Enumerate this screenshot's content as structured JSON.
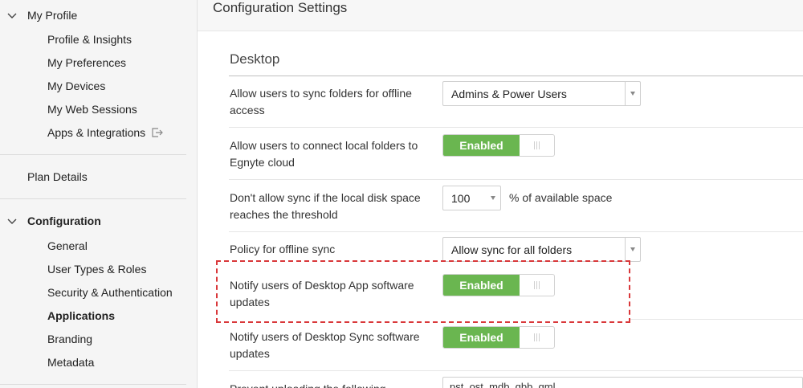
{
  "sidebar": {
    "my_profile": {
      "label": "My Profile",
      "items": [
        "Profile & Insights",
        "My Preferences",
        "My Devices",
        "My Web Sessions",
        "Apps & Integrations"
      ]
    },
    "plan_details": "Plan Details",
    "configuration": {
      "label": "Configuration",
      "items": [
        "General",
        "User Types & Roles",
        "Security & Authentication",
        "Applications",
        "Branding",
        "Metadata"
      ],
      "active": "Applications"
    }
  },
  "header": {
    "title": "Configuration Settings"
  },
  "desktop": {
    "title": "Desktop",
    "rows": [
      {
        "label": "Allow users to sync folders for offline access",
        "control": "select",
        "value": "Admins & Power Users"
      },
      {
        "label": "Allow users to connect local folders to Egnyte cloud",
        "control": "toggle",
        "value": "Enabled"
      },
      {
        "label": "Don't allow sync if the local disk space reaches the threshold",
        "control": "select",
        "value": "100",
        "suffix": "% of available space"
      },
      {
        "label": "Policy for offline sync",
        "control": "select",
        "value": "Allow sync for all folders"
      },
      {
        "label": "Notify users of Desktop App software updates",
        "control": "toggle",
        "value": "Enabled",
        "highlighted": true
      },
      {
        "label": "Notify users of Desktop Sync software updates",
        "control": "toggle",
        "value": "Enabled"
      },
      {
        "label": "Prevent uploading the following",
        "control": "text",
        "value": "pst, ost, mdb, qbb, qml"
      }
    ]
  },
  "colors": {
    "toggle_on": "#6ab650",
    "highlight_border": "#d9383a",
    "sidebar_bg": "#f5f5f5"
  }
}
